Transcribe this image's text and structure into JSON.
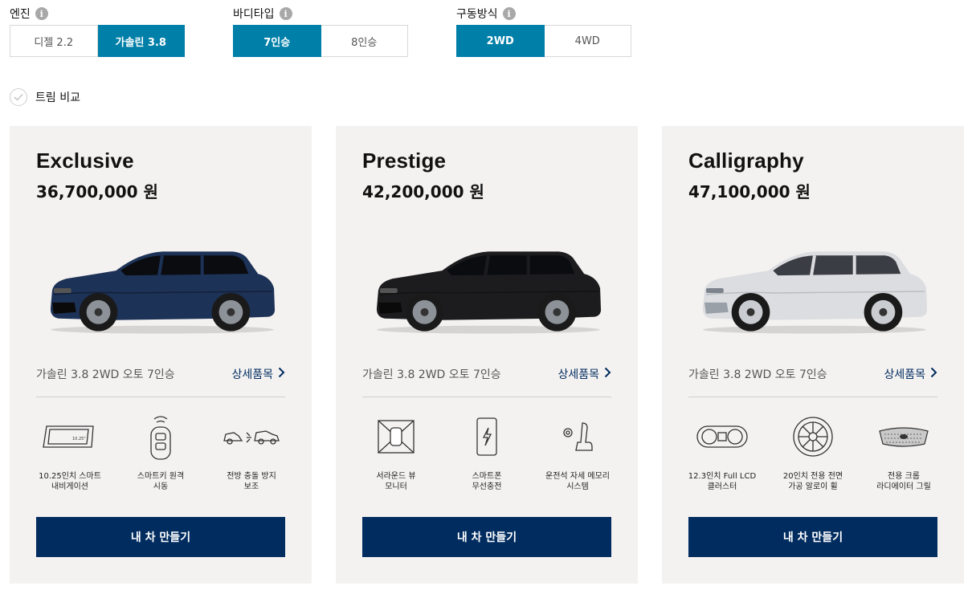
{
  "filters": {
    "engine": {
      "label": "엔진",
      "options": [
        "디젤 2.2",
        "가솔린 3.8"
      ],
      "selected": 1
    },
    "body": {
      "label": "바디타입",
      "options": [
        "7인승",
        "8인승"
      ],
      "selected": 0
    },
    "drive": {
      "label": "구동방식",
      "options": [
        "2WD",
        "4WD"
      ],
      "selected": 0
    }
  },
  "compare_label": "트림 비교",
  "cards": [
    {
      "name": "Exclusive",
      "price": "36,700,000 원",
      "car_color": "#1d3257",
      "spec": "가솔린 3.8 2WD 오토 7인승",
      "detail_label": "상세품목",
      "features": [
        {
          "icon": "navigation-screen-icon",
          "label": "10.25인치 스마트\n내비게이션"
        },
        {
          "icon": "smart-key-icon",
          "label": "스마트키 원격\n시동"
        },
        {
          "icon": "collision-assist-icon",
          "label": "전방 충돌 방지\n보조"
        }
      ],
      "cta": "내 차 만들기"
    },
    {
      "name": "Prestige",
      "price": "42,200,000 원",
      "car_color": "#1c1c1e",
      "spec": "가솔린 3.8 2WD 오토 7인승",
      "detail_label": "상세품목",
      "features": [
        {
          "icon": "surround-view-icon",
          "label": "서라운드 뷰\n모니터"
        },
        {
          "icon": "wireless-charge-icon",
          "label": "스마트폰\n무선충전"
        },
        {
          "icon": "seat-memory-icon",
          "label": "운전석 자세 메모리\n시스템"
        }
      ],
      "cta": "내 차 만들기"
    },
    {
      "name": "Calligraphy",
      "price": "47,100,000 원",
      "car_color": "#dcdde0",
      "spec": "가솔린 3.8 2WD 오토 7인승",
      "detail_label": "상세품목",
      "features": [
        {
          "icon": "cluster-icon",
          "label": "12.3인치 Full LCD\n클러스터"
        },
        {
          "icon": "alloy-wheel-icon",
          "label": "20인치 전용 전면\n가공 알로이 휠"
        },
        {
          "icon": "radiator-grille-icon",
          "label": "전용 크롬\n라디에이터 그릴"
        }
      ],
      "cta": "내 차 만들기"
    }
  ]
}
